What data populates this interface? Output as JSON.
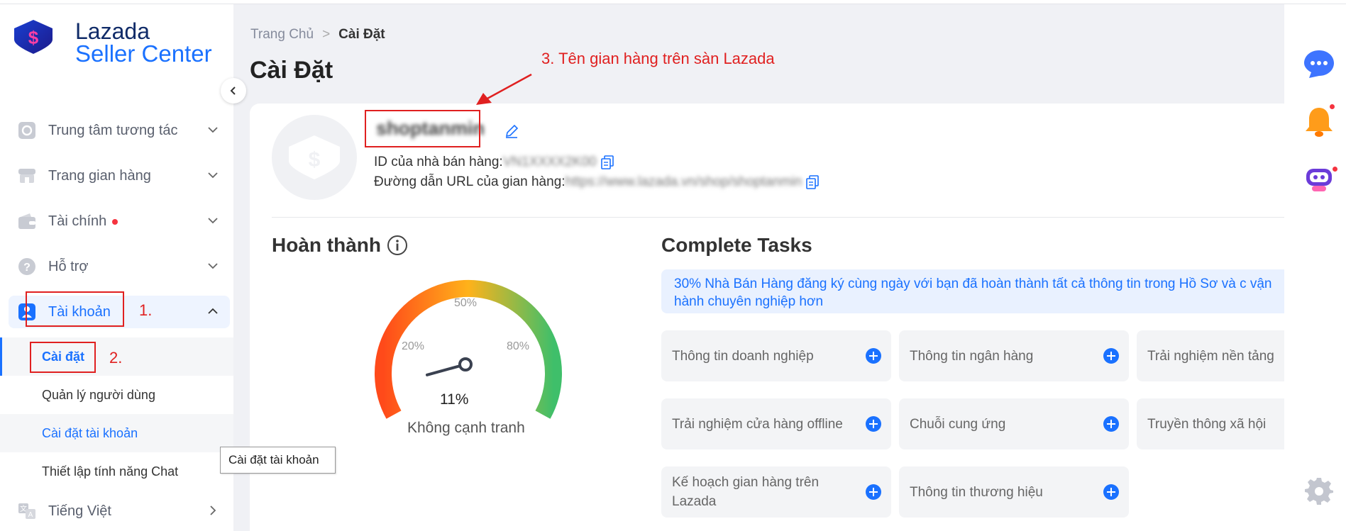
{
  "logo": {
    "line1": "Lazada",
    "line2": "Seller Center"
  },
  "sidebar": {
    "items": [
      {
        "label": "Trung tâm tương tác",
        "icon": "engagement-icon"
      },
      {
        "label": "Trang gian hàng",
        "icon": "store-icon"
      },
      {
        "label": "Tài chính",
        "icon": "wallet-icon",
        "badge": true
      },
      {
        "label": "Hỗ trợ",
        "icon": "help-icon"
      },
      {
        "label": "Tài khoản",
        "icon": "account-icon",
        "expanded": true
      }
    ],
    "subitems": [
      {
        "label": "Cài đặt",
        "current": true
      },
      {
        "label": "Quản lý người dùng"
      },
      {
        "label": "Cài đặt tài khoản",
        "hover": true
      },
      {
        "label": "Thiết lập tính năng Chat"
      }
    ],
    "language": "Tiếng Việt",
    "tooltip": "Cài đặt tài khoản"
  },
  "annotations": {
    "step1": "1.",
    "step2": "2.",
    "step3": "3. Tên gian hàng trên sàn Lazada"
  },
  "breadcrumb": {
    "home": "Trang Chủ",
    "current": "Cài Đặt"
  },
  "page_title": "Cài Đặt",
  "profile": {
    "shop_name": "shoptanmin",
    "seller_id_label": "ID của nhà bán hàng: ",
    "seller_id_value": "VN1XXXX2K00",
    "url_label": "Đường dẫn URL của gian hàng: ",
    "url_value": "https://www.lazada.vn/shop/shoptanmin"
  },
  "completion": {
    "title": "Hoàn thành",
    "percent": 11,
    "percent_label": "11%",
    "status": "Không cạnh tranh",
    "ticks": [
      "20%",
      "50%",
      "80%"
    ]
  },
  "tasks": {
    "title": "Complete Tasks",
    "banner": "30% Nhà Bán Hàng đăng ký cùng ngày với bạn đã hoàn thành tất cả thông tin trong Hồ Sơ và c vận hành chuyên nghiệp hơn",
    "items": [
      "Thông tin doanh nghiệp",
      "Thông tin ngân hàng",
      "Trải nghiệm nền tảng",
      "Trải nghiệm cửa hàng offline",
      "Chuỗi cung ứng",
      "Truyền thông xã hội",
      "Kế hoạch gian hàng trên Lazada",
      "Thông tin thương hiệu"
    ]
  },
  "colors": {
    "brand_blue": "#1a71ff",
    "annotation_red": "#e02020",
    "alert_red": "#f5333f"
  }
}
